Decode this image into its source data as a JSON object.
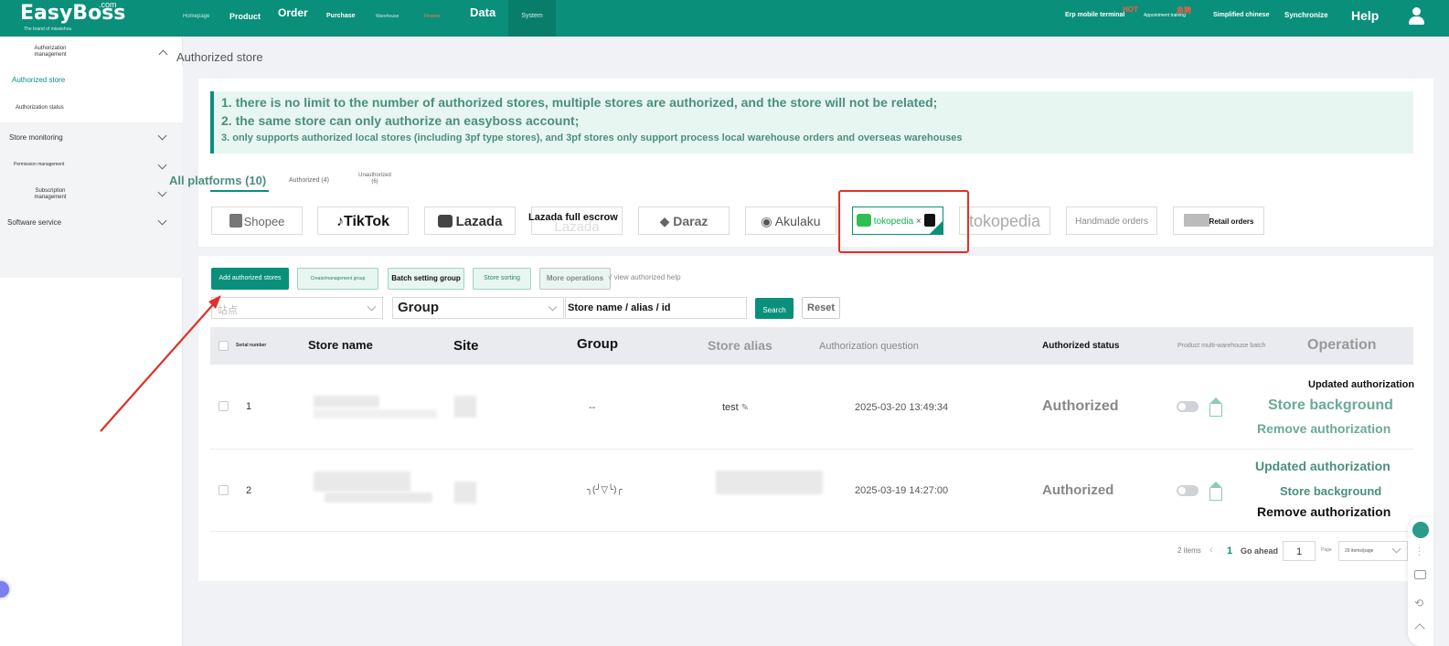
{
  "app": {
    "brand": "EasyBoss",
    "brand_suffix": ".com",
    "tagline": "The brand of missiehou"
  },
  "nav": {
    "items": [
      {
        "label": "Homepage"
      },
      {
        "label": "Product"
      },
      {
        "label": "Order"
      },
      {
        "label": "Purchase"
      },
      {
        "label": "Warehouse"
      },
      {
        "label": "Finance"
      },
      {
        "label": "Data"
      },
      {
        "label": "System"
      }
    ],
    "right": {
      "mobile": "Erp mobile terminal",
      "hot_badge": "HOT",
      "training": "Appointment training",
      "training_badge": "急聘",
      "language": "Simplified chinese",
      "sync": "Synchronize",
      "help": "Help"
    }
  },
  "sidebar": {
    "auth_mgmt": "Authorization management",
    "authorized_store": "Authorized store",
    "auth_status": "Authorization status",
    "store_monitoring": "Store monitoring",
    "permission": "Permission management",
    "subscription": "Subscription management",
    "software": "Software service"
  },
  "page": {
    "title": "Authorized store"
  },
  "notice": {
    "line1": "1. there is no limit to the number of authorized stores, multiple stores are authorized, and the store will not be related;",
    "line2": "2. the same store can only authorize an easyboss account;",
    "line3": "3. only supports authorized local stores (including 3pf type stores), and 3pf stores only support process local warehouse orders and overseas warehouses"
  },
  "tabs": {
    "all": "All platforms (10)",
    "authorized": "Authorized (4)",
    "unauthorized": "Unauthorized (6)"
  },
  "platforms": {
    "shopee": "Shopee",
    "tiktok": "TikTok",
    "lazada": "Lazada",
    "lazada_full": "Lazada full escrow",
    "daraz": "Daraz",
    "akulaku": "Akulaku",
    "tokopedia_x": "tokopedia",
    "tokopedia": "tokopedia",
    "handmade": "Handmade orders",
    "retail": "Retail orders"
  },
  "toolbar": {
    "add": "Add authorized stores",
    "create_group": "Create/management group",
    "batch_group": "Batch setting group",
    "sorting": "Store sorting",
    "more": "More operations",
    "help": "√ view authorized help"
  },
  "filters": {
    "site_placeholder": "站点",
    "group_placeholder": "Group",
    "store_placeholder": "Store name / alias / id",
    "search": "Search",
    "reset": "Reset"
  },
  "table": {
    "headers": {
      "serial": "Serial number",
      "name": "Store name",
      "site": "Site",
      "group": "Group",
      "alias": "Store alias",
      "question": "Authorization question",
      "status": "Authorized status",
      "multi": "Product multi-warehouse batch",
      "operation": "Operation"
    },
    "rows": [
      {
        "serial": "1",
        "group": "--",
        "alias": "test",
        "time": "2025-03-20 13:49:34",
        "status": "Authorized",
        "op_update": "Updated authorization",
        "op_background": "Store background",
        "op_remove": "Remove authorization"
      },
      {
        "serial": "2",
        "group": "╮(╯▽╰)╭",
        "alias": "",
        "time": "2025-03-19 14:27:00",
        "status": "Authorized",
        "op_update": "Updated authorization",
        "op_background": "Store background",
        "op_remove": "Remove authorization"
      }
    ]
  },
  "pagination": {
    "total": "2 items",
    "current": "1",
    "go_ahead": "Go ahead",
    "page_value": "1",
    "page_suffix": "Page",
    "page_size": "20 items/page"
  },
  "colors": {
    "primary": "#0a8f7a",
    "annotation": "#e03128"
  }
}
